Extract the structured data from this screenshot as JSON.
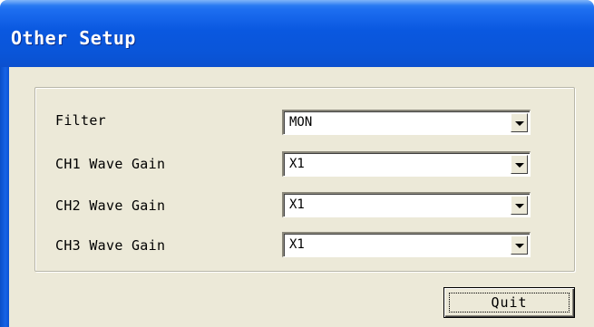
{
  "window": {
    "title": "Other Setup"
  },
  "settings": [
    {
      "label": "Filter",
      "value": "MON"
    },
    {
      "label": "CH1 Wave Gain",
      "value": "X1"
    },
    {
      "label": "CH2 Wave Gain",
      "value": "X1"
    },
    {
      "label": "CH3 Wave Gain",
      "value": "X1"
    }
  ],
  "buttons": {
    "quit_label": "Quit"
  },
  "icons": {
    "dropdown": "chevron-down-icon"
  },
  "colors": {
    "titlebar": "#0a58e0",
    "dialog_bg": "#ece9d8",
    "title_text": "#ffffff"
  }
}
